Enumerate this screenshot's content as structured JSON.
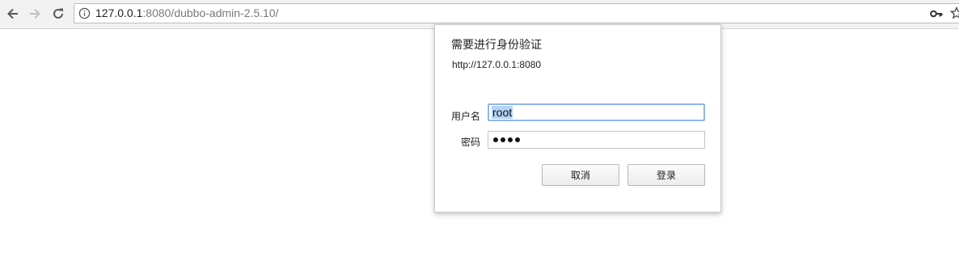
{
  "browser": {
    "url_host": "127.0.0.1",
    "url_rest": ":8080/dubbo-admin-2.5.10/",
    "icons": {
      "back": "back-arrow-icon",
      "forward": "forward-arrow-icon",
      "reload": "reload-icon",
      "site_info": "info-icon",
      "passwords": "key-icon",
      "bookmark": "star-icon"
    }
  },
  "auth_dialog": {
    "title": "需要进行身份验证",
    "origin": "http://127.0.0.1:8080",
    "username_label": "用户名",
    "username_value": "root",
    "password_label": "密码",
    "password_mask_length": 4,
    "cancel_label": "取消",
    "login_label": "登录"
  },
  "colors": {
    "focus_ring": "#8fb8e8",
    "selection": "#b3d3f8"
  }
}
